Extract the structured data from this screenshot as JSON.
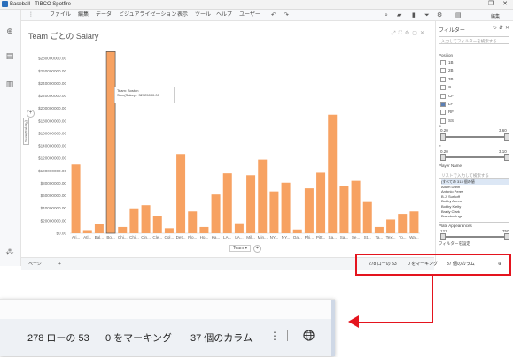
{
  "window": {
    "title": "Baseball - TIBCO Spotfire",
    "minimize": "—",
    "maximize": "❐",
    "close": "✕"
  },
  "menu": {
    "items": [
      "ファイル",
      "編集",
      "データ",
      "ビジュアライゼーション",
      "表示",
      "ツール",
      "ヘルプ",
      "ユーザー"
    ],
    "mode_label": "編集"
  },
  "visualization": {
    "title": "Team ごとの Salary",
    "y_axis_selector": "Sum(Salary)",
    "x_axis_selector": "Team"
  },
  "tooltip": {
    "line1": "Team: Boston",
    "line2": "Sum(Salary): 32725000.00"
  },
  "chart_data": {
    "type": "bar",
    "title": "Team ごとの Salary",
    "ylabel": "Sum(Salary)",
    "xlabel": "Team",
    "ylim": [
      0,
      300000000
    ],
    "ytick_labels": [
      "$0.00",
      "$20000000.00",
      "$40000000.00",
      "$60000000.00",
      "$80000000.00",
      "$100000000.00",
      "$120000000.00",
      "$140000000.00",
      "$160000000.00",
      "$180000000.00",
      "$200000000.00",
      "$220000000.00",
      "$240000000.00",
      "$260000000.00",
      "$280000000.00"
    ],
    "yticks": [
      0,
      20000000,
      40000000,
      60000000,
      80000000,
      100000000,
      120000000,
      140000000,
      160000000,
      180000000,
      200000000,
      220000000,
      240000000,
      260000000,
      280000000
    ],
    "categories": [
      "Ari...",
      "Atl...",
      "Bal...",
      "Bo...",
      "Chi...",
      "Chi...",
      "Cin...",
      "Cle...",
      "Col...",
      "Det...",
      "Flo...",
      "Ho...",
      "Ka...",
      "LA...",
      "LA...",
      "Mil...",
      "Min...",
      "NY...",
      "NY...",
      "Oa...",
      "Phi...",
      "Pitt...",
      "Sa...",
      "Sa...",
      "Se...",
      "St...",
      "Ta...",
      "Tex...",
      "To...",
      "Wa..."
    ],
    "tick_labels_shown": [
      "Ari...",
      "Atl...",
      "Bal...",
      "Bo...",
      "Chi...",
      "Chi...",
      "Cin...",
      "Cle...",
      "Col...",
      "Det...",
      "Flo...",
      "Ho...",
      "Ka...",
      "LA...",
      "LA...",
      "Mil...",
      "Min...",
      "NY...",
      "NY...",
      "Oa...",
      "Phi...",
      "Pitt...",
      "Sa...",
      "Sa...",
      "Se...",
      "St...",
      "Ta...",
      "Tex...",
      "To...",
      "Wa..."
    ],
    "values": [
      110000000,
      5000000,
      15000000,
      291000000,
      10000000,
      40000000,
      45000000,
      28000000,
      8000000,
      127000000,
      35000000,
      10000000,
      62000000,
      96000000,
      16000000,
      93000000,
      118000000,
      67000000,
      81000000,
      6000000,
      72000000,
      97000000,
      190000000,
      75000000,
      84000000,
      50000000,
      10000000,
      22000000,
      31000000,
      35000000
    ],
    "highlighted_category": "Bo...",
    "bar_color": "#f7a262",
    "highlight_outline": "#555555",
    "grid": false
  },
  "filters": {
    "header": "フィルター",
    "search_placeholder": "入力してフィルターを検索する",
    "position_title": "Position",
    "position_options": [
      {
        "label": "1B",
        "checked": false
      },
      {
        "label": "2B",
        "checked": false
      },
      {
        "label": "3B",
        "checked": false
      },
      {
        "label": "C",
        "checked": false
      },
      {
        "label": "CF",
        "checked": false
      },
      {
        "label": "LF",
        "checked": true
      },
      {
        "label": "RF",
        "checked": false
      },
      {
        "label": "SS",
        "checked": false
      }
    ],
    "range1_title": "E",
    "range1_min": "0.20",
    "range1_max": "3.60",
    "range2_title": "F",
    "range2_min": "0.20",
    "range2_max": "3.10",
    "player_title": "Player Name",
    "player_search": "リストで入力して検索する",
    "players": [
      "(すべての 313 個の値",
      "Adam Dunn",
      "Antonio Perez",
      "B.J. Surhoff",
      "Bobby Abreu",
      "Bobby Kielty",
      "Brady Clark",
      "Brandon Inge"
    ],
    "plate_title": "Plate Appearances",
    "plate_min": "121",
    "plate_max": "750",
    "add_filter": "フィルターを設定"
  },
  "pagebar": {
    "tab": "ページ",
    "add": "+"
  },
  "status": {
    "rows": "278 ローの 53",
    "marked": "0 をマーキング",
    "columns": "37 個のカラム",
    "more": "⋮"
  },
  "status_zoom": {
    "rows": "278 ローの 53",
    "marked": "0 をマーキング",
    "columns": "37 個のカラム",
    "more": "⋮"
  },
  "colors": {
    "accent_red": "#e4141e",
    "bar": "#f7a262"
  }
}
